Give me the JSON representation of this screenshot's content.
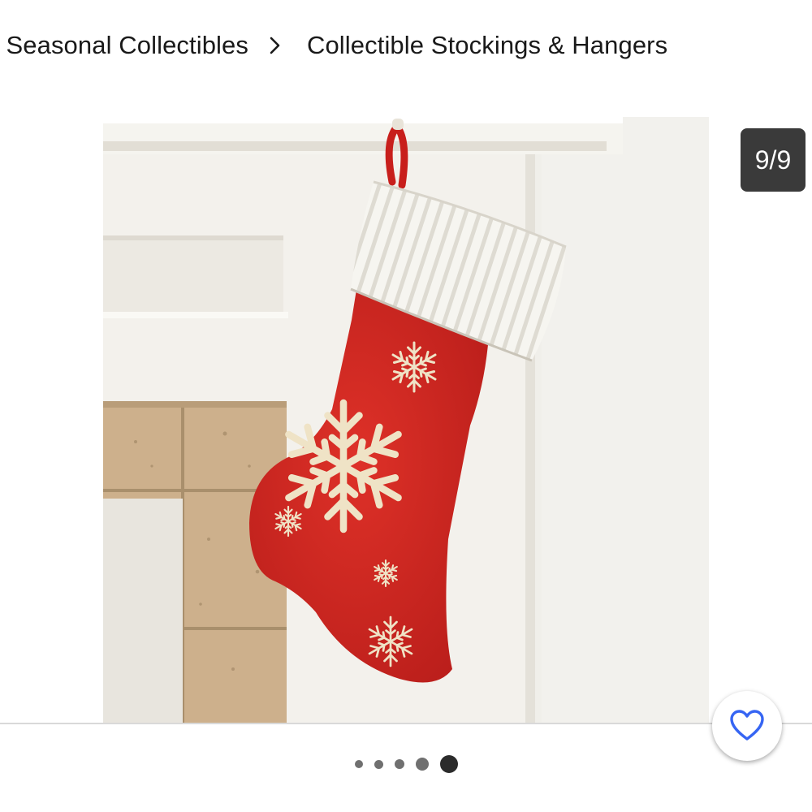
{
  "breadcrumb": {
    "items": [
      {
        "label": "& Seasonal Collectibles"
      },
      {
        "label": "Collectible Stockings & Hangers"
      }
    ],
    "separator_icon": "chevron-right-icon"
  },
  "gallery": {
    "counter": "9/9",
    "image_subject": "red christmas stocking with white ribbed cuff and cream embroidered snowflakes hanging from a white mantel",
    "dots_count": 5,
    "active_dot": 5
  },
  "actions": {
    "favorite_icon": "heart-icon"
  },
  "colors": {
    "accent": "#3665f3",
    "stocking_red": "#d42a24",
    "counter_bg": "#3a3a3a"
  }
}
